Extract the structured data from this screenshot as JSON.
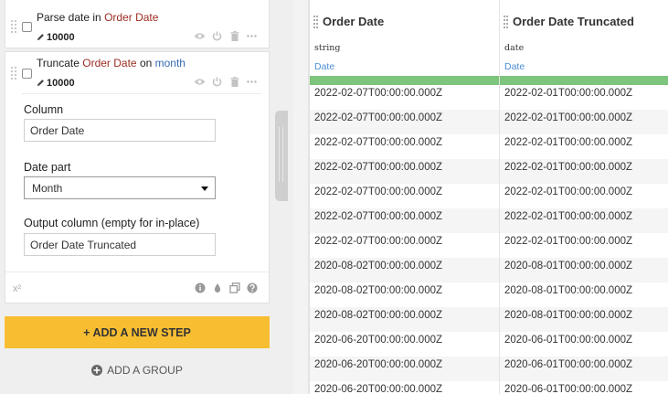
{
  "steps": [
    {
      "title_parts": [
        "Parse date",
        " in ",
        "Order Date"
      ],
      "rows": "10000"
    },
    {
      "title_parts": [
        "Truncate ",
        "Order Date",
        " on ",
        "month"
      ],
      "rows": "10000",
      "form": {
        "column_label": "Column",
        "column_value": "Order Date",
        "datepart_label": "Date part",
        "datepart_value": "Month",
        "output_label": "Output column (empty for in-place)",
        "output_value": "Order Date Truncated"
      },
      "footer_symbol": "x²"
    }
  ],
  "actions": {
    "add_step": "+ ADD A NEW STEP",
    "add_group": "ADD A GROUP"
  },
  "icons": {
    "row_count": "pencil-icon",
    "step_actions": [
      "eye-icon",
      "power-icon",
      "trash-icon",
      "more-icon"
    ],
    "footer_actions": [
      "info-icon",
      "drop-icon",
      "copy-icon",
      "help-icon"
    ]
  },
  "colors": {
    "accent": "#f8be32",
    "column_ref": "#9b2c22",
    "param_ref": "#3468b0",
    "quality_bar": "#7dc47c",
    "semantic_type": "#4c8ed4"
  },
  "table": {
    "columns": [
      {
        "name": "Order Date",
        "type": "string",
        "semantic": "Date"
      },
      {
        "name": "Order Date Truncated",
        "type": "date",
        "semantic": "Date"
      }
    ],
    "rows": [
      [
        "2022-02-07T00:00:00.000Z",
        "2022-02-01T00:00:00.000Z"
      ],
      [
        "2022-02-07T00:00:00.000Z",
        "2022-02-01T00:00:00.000Z"
      ],
      [
        "2022-02-07T00:00:00.000Z",
        "2022-02-01T00:00:00.000Z"
      ],
      [
        "2022-02-07T00:00:00.000Z",
        "2022-02-01T00:00:00.000Z"
      ],
      [
        "2022-02-07T00:00:00.000Z",
        "2022-02-01T00:00:00.000Z"
      ],
      [
        "2022-02-07T00:00:00.000Z",
        "2022-02-01T00:00:00.000Z"
      ],
      [
        "2022-02-07T00:00:00.000Z",
        "2022-02-01T00:00:00.000Z"
      ],
      [
        "2020-08-02T00:00:00.000Z",
        "2020-08-01T00:00:00.000Z"
      ],
      [
        "2020-08-02T00:00:00.000Z",
        "2020-08-01T00:00:00.000Z"
      ],
      [
        "2020-08-02T00:00:00.000Z",
        "2020-08-01T00:00:00.000Z"
      ],
      [
        "2020-06-20T00:00:00.000Z",
        "2020-06-01T00:00:00.000Z"
      ],
      [
        "2020-06-20T00:00:00.000Z",
        "2020-06-01T00:00:00.000Z"
      ],
      [
        "2020-06-20T00:00:00.000Z",
        "2020-06-01T00:00:00.000Z"
      ]
    ]
  }
}
